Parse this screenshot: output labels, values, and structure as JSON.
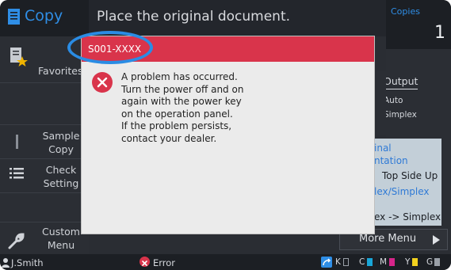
{
  "app": {
    "title": "Copy"
  },
  "header": {
    "message": "Place the original document."
  },
  "copies": {
    "label": "Copies",
    "value": "1"
  },
  "sidebar": {
    "favorites": "Favorites",
    "sample_copy": [
      "Sample",
      "Copy"
    ],
    "check_setting": [
      "Check",
      "Setting"
    ],
    "custom_menu": [
      "Custom",
      "Menu"
    ]
  },
  "right_panel": {
    "output_label": "Output",
    "output_values": [
      "Auto",
      "Simplex"
    ],
    "orientation_label": [
      "inal",
      "ntation"
    ],
    "orientation_value": "Top Side Up",
    "duplex_label": "lex/Simplex",
    "duplex_value": "ex -> Simplex",
    "more_menu": "More Menu"
  },
  "dialog": {
    "code": "S001-XXXX",
    "message_lines": [
      "A problem has occurred.",
      "Turn the power off and on",
      "again with the power key",
      "on the operation panel.",
      "If the problem persists,",
      "contact your dealer."
    ]
  },
  "status_bar": {
    "user": "J.Smith",
    "status": "Error",
    "toner": [
      "K",
      "C",
      "M",
      "Y",
      "G"
    ]
  },
  "colors": {
    "accent_blue": "#2f8ee6",
    "error_red": "#d9344b",
    "toner_cyan": "#19a6d8",
    "toner_magenta": "#d6258a",
    "toner_yellow": "#f2d11e",
    "toner_gray": "#9aa0a8"
  }
}
